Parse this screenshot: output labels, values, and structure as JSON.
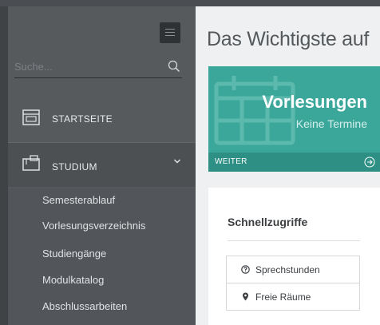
{
  "search": {
    "placeholder": "Suche..."
  },
  "sidebar": {
    "items": [
      {
        "label": "STARTSEITE",
        "icon": "window-icon"
      },
      {
        "label": "STUDIUM",
        "icon": "folder-tree-icon",
        "expanded": true
      }
    ],
    "subitems": [
      {
        "label": "Semesterablauf"
      },
      {
        "label": "Vorlesungsverzeichnis"
      },
      {
        "label": "Studiengänge"
      },
      {
        "label": "Modulkatalog"
      },
      {
        "label": "Abschlussarbeiten"
      }
    ]
  },
  "main": {
    "title": "Das Wichtigste auf",
    "tile": {
      "title": "Vorlesungen",
      "subtitle": "Keine Termine",
      "footer_label": "WEITER",
      "color": "#3aa79a"
    },
    "quick_access": {
      "title": "Schnellzugriffe",
      "items": [
        {
          "label": "Sprechstunden",
          "icon": "question-circle-icon"
        },
        {
          "label": "Freie Räume",
          "icon": "map-marker-icon"
        }
      ]
    }
  },
  "colors": {
    "sidebar": "#575a5d",
    "sidebar_active": "#4d5053",
    "accent": "#3aa79a",
    "main_bg": "#eef0f1"
  }
}
